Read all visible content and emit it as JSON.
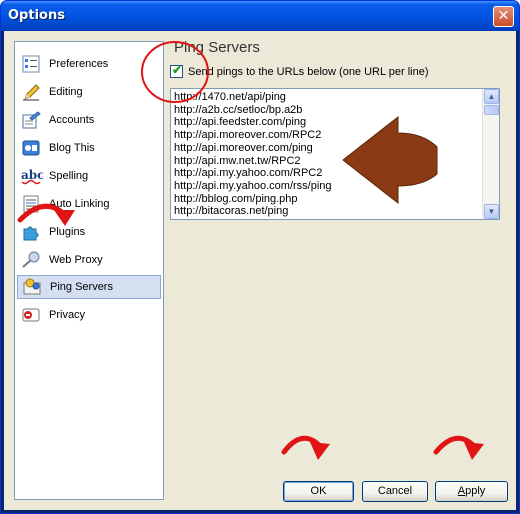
{
  "window": {
    "title": "Options",
    "close_glyph": "✕"
  },
  "sidebar": {
    "items": [
      {
        "label": "Preferences",
        "icon": "preferences-icon"
      },
      {
        "label": "Editing",
        "icon": "pencil-icon"
      },
      {
        "label": "Accounts",
        "icon": "accounts-icon"
      },
      {
        "label": "Blog This",
        "icon": "blog-this-icon"
      },
      {
        "label": "Spelling",
        "icon": "abc-spelling-icon"
      },
      {
        "label": "Auto Linking",
        "icon": "auto-linking-icon"
      },
      {
        "label": "Plugins",
        "icon": "plugins-icon"
      },
      {
        "label": "Web Proxy",
        "icon": "web-proxy-icon"
      },
      {
        "label": "Ping Servers",
        "icon": "ping-servers-icon",
        "selected": true
      },
      {
        "label": "Privacy",
        "icon": "privacy-icon"
      }
    ]
  },
  "main": {
    "section_title": "Ping Servers",
    "checkbox_label": "Send pings to the URLs below (one URL per line)",
    "checkbox_checked": true,
    "urls": [
      "http://1470.net/api/ping",
      "http://a2b.cc/setloc/bp.a2b",
      "http://api.feedster.com/ping",
      "http://api.moreover.com/RPC2",
      "http://api.moreover.com/ping",
      "http://api.mw.net.tw/RPC2",
      "http://api.my.yahoo.com/RPC2",
      "http://api.my.yahoo.com/rss/ping",
      "http://bblog.com/ping.php",
      "http://bitacoras.net/ping"
    ]
  },
  "buttons": {
    "ok": "OK",
    "cancel": "Cancel",
    "apply_prefix": "A",
    "apply_rest": "pply"
  },
  "colors": {
    "annotation_red": "#e01414",
    "arrow_brown": "#8a3b13",
    "selection": "#d4dff2"
  }
}
